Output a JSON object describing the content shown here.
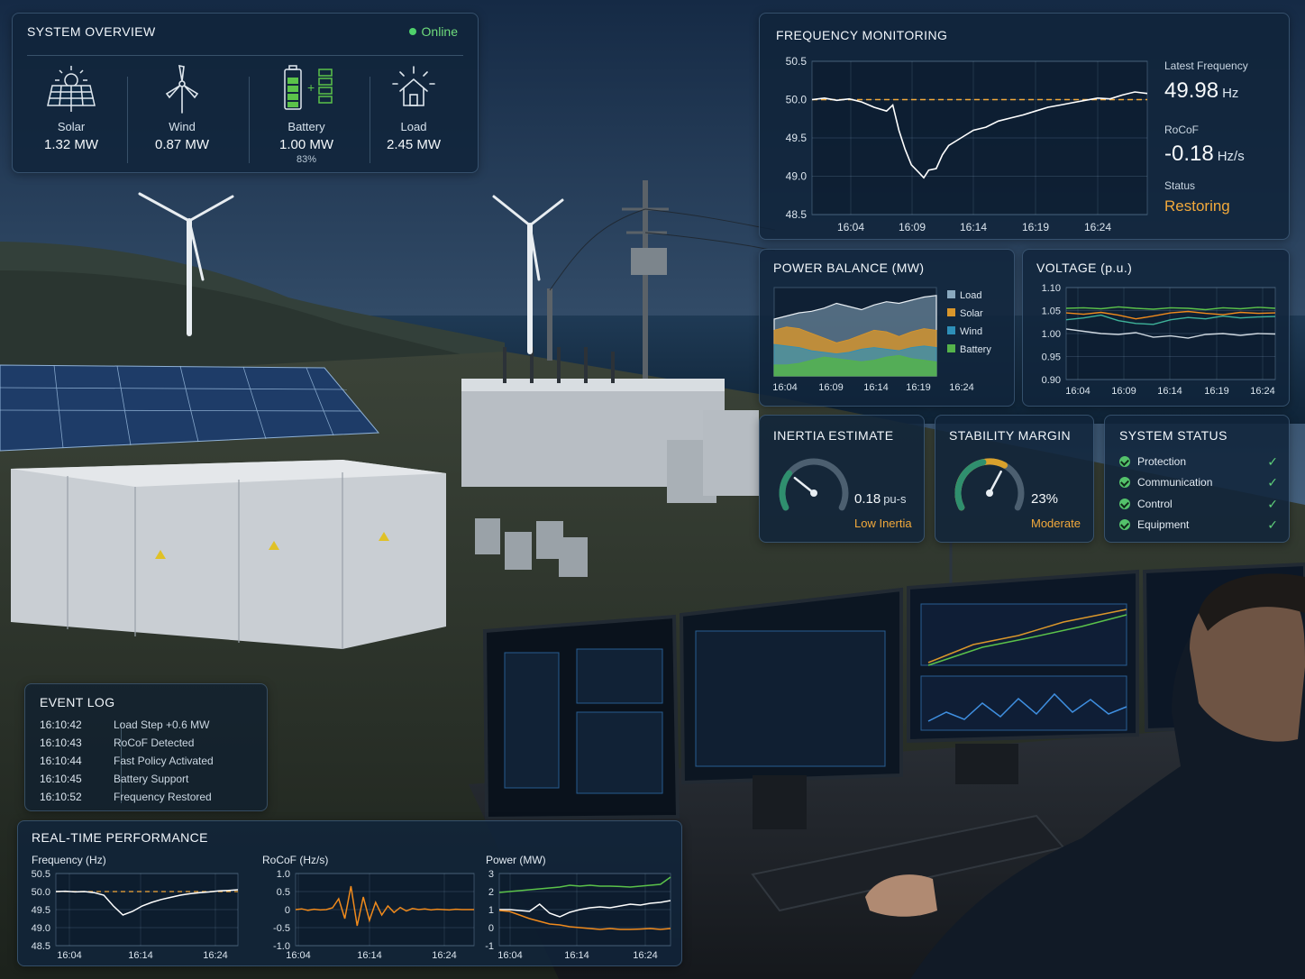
{
  "system_overview": {
    "title": "SYSTEM OVERVIEW",
    "status": "Online",
    "sources": [
      {
        "label": "Solar",
        "value": "1.32 MW",
        "icon": "solar-panel-icon"
      },
      {
        "label": "Wind",
        "value": "0.87 MW",
        "icon": "wind-turbine-icon"
      },
      {
        "label": "Battery",
        "value": "1.00 MW",
        "sub": "83%",
        "icon": "battery-icon"
      },
      {
        "label": "Load",
        "value": "2.45 MW",
        "icon": "house-load-icon"
      }
    ]
  },
  "frequency_monitoring": {
    "title": "FREQUENCY MONITORING",
    "latest_label": "Latest Frequency",
    "latest_value": "49.98",
    "latest_unit": "Hz",
    "rocof_label": "RoCoF",
    "rocof_value": "-0.18",
    "rocof_unit": "Hz/s",
    "status_label": "Status",
    "status_value": "Restoring"
  },
  "power_balance": {
    "title": "POWER BALANCE (MW)"
  },
  "voltage": {
    "title": "VOLTAGE (p.u.)"
  },
  "inertia": {
    "title": "INERTIA ESTIMATE",
    "value": "0.18",
    "unit": "pu-s",
    "note": "Low Inertia"
  },
  "stability": {
    "title": "STABILITY MARGIN",
    "value": "23%",
    "note": "Moderate"
  },
  "system_status": {
    "title": "SYSTEM STATUS",
    "items": [
      {
        "label": "Protection"
      },
      {
        "label": "Communication"
      },
      {
        "label": "Control"
      },
      {
        "label": "Equipment"
      }
    ]
  },
  "event_log": {
    "title": "EVENT LOG",
    "events": [
      {
        "time": "16:10:42",
        "text": "Load Step +0.6 MW"
      },
      {
        "time": "16:10:43",
        "text": "RoCoF Detected"
      },
      {
        "time": "16:10:44",
        "text": "Fast Policy Activated"
      },
      {
        "time": "16:10:45",
        "text": "Battery Support"
      },
      {
        "time": "16:10:52",
        "text": "Frequency Restored"
      }
    ]
  },
  "realtime": {
    "title": "REAL-TIME PERFORMANCE"
  },
  "colors": {
    "accent_orange": "#f2a93b",
    "online_green": "#4fd16b",
    "load": "#8aa9bf",
    "solar": "#d9962b",
    "wind": "#2e8fb8",
    "battery": "#55b34b",
    "trace_white": "#ffffff",
    "trace_orange": "#f08a1c",
    "trace_green": "#5bc24a"
  },
  "chart_data": [
    {
      "id": "freq_main",
      "type": "line",
      "title": "FREQUENCY MONITORING",
      "ylim": [
        48.5,
        50.5
      ],
      "y_ticks": [
        "48.5",
        "49.0",
        "49.5",
        "50.0",
        "50.5"
      ],
      "x_ticks": [
        "16:04",
        "16:09",
        "16:14",
        "16:19",
        "16:24"
      ],
      "xlim": [
        0,
        27
      ],
      "grid": true,
      "reference": 50.0,
      "series": [
        {
          "x": [
            0,
            1,
            2,
            3,
            4,
            5,
            6,
            6.5,
            7,
            7.5,
            8,
            8.6,
            9,
            9.4,
            10,
            10.5,
            11,
            12,
            13,
            14,
            15,
            16,
            17,
            18,
            19,
            20,
            21,
            22,
            23,
            24,
            25,
            26,
            27
          ],
          "y": [
            50.0,
            50.02,
            49.99,
            50.01,
            49.97,
            49.9,
            49.85,
            49.93,
            49.6,
            49.35,
            49.15,
            49.05,
            48.98,
            49.08,
            49.1,
            49.28,
            49.4,
            49.5,
            49.6,
            49.64,
            49.72,
            49.76,
            49.8,
            49.85,
            49.9,
            49.93,
            49.96,
            49.99,
            50.02,
            50.01,
            50.06,
            50.1,
            50.08
          ]
        }
      ]
    },
    {
      "id": "power_balance",
      "type": "area",
      "title": "POWER BALANCE (MW)",
      "x_ticks": [
        "16:04",
        "16:09",
        "16:14",
        "16:19",
        "16:24"
      ],
      "legend": "right",
      "series": [
        {
          "name": "Load",
          "values": [
            1.8,
            1.9,
            2.0,
            2.05,
            2.15,
            2.3,
            2.2,
            2.1,
            2.25,
            2.35,
            2.3,
            2.4,
            2.5,
            2.55
          ]
        },
        {
          "name": "Solar",
          "values": [
            1.45,
            1.55,
            1.5,
            1.35,
            1.2,
            1.05,
            1.15,
            1.3,
            1.45,
            1.4,
            1.25,
            1.4,
            1.5,
            1.45
          ]
        },
        {
          "name": "Wind",
          "values": [
            1.0,
            0.95,
            0.9,
            0.8,
            0.75,
            0.7,
            0.75,
            0.85,
            0.9,
            0.85,
            0.8,
            0.9,
            0.95,
            0.9
          ]
        },
        {
          "name": "Battery",
          "values": [
            0.35,
            0.35,
            0.4,
            0.5,
            0.6,
            0.55,
            0.5,
            0.45,
            0.5,
            0.6,
            0.65,
            0.55,
            0.5,
            0.45
          ]
        }
      ]
    },
    {
      "id": "voltage",
      "type": "line",
      "title": "VOLTAGE (p.u.)",
      "ylim": [
        0.9,
        1.1
      ],
      "y_ticks": [
        "1.10",
        "1.05",
        "1.00",
        "0.95",
        "0.90"
      ],
      "x_ticks": [
        "16:04",
        "16:09",
        "16:14",
        "16:19",
        "16:24"
      ],
      "series": [
        {
          "color": "#5bc24a",
          "values": [
            1.055,
            1.056,
            1.054,
            1.058,
            1.055,
            1.053,
            1.056,
            1.055,
            1.052,
            1.056,
            1.054,
            1.057,
            1.055
          ]
        },
        {
          "color": "#f08a1c",
          "values": [
            1.045,
            1.042,
            1.046,
            1.04,
            1.032,
            1.038,
            1.045,
            1.048,
            1.044,
            1.041,
            1.046,
            1.044,
            1.045
          ]
        },
        {
          "color": "#3fb39a",
          "values": [
            1.03,
            1.034,
            1.04,
            1.028,
            1.022,
            1.02,
            1.03,
            1.035,
            1.032,
            1.038,
            1.034,
            1.036,
            1.037
          ]
        },
        {
          "color": "#cfd8e0",
          "values": [
            1.01,
            1.005,
            1.0,
            0.998,
            1.002,
            0.992,
            0.995,
            0.99,
            0.998,
            1.0,
            0.996,
            1.0,
            0.999
          ]
        }
      ]
    },
    {
      "id": "inertia_gauge",
      "type": "gauge",
      "value": 0.18,
      "fraction": 0.28
    },
    {
      "id": "stability_gauge",
      "type": "gauge",
      "value": 23,
      "fraction": 0.62
    },
    {
      "id": "rt_freq",
      "type": "line",
      "title": "Frequency (Hz)",
      "ylim": [
        48.5,
        50.5
      ],
      "y_ticks": [
        "50.5",
        "50.0",
        "49.5",
        "49.0",
        "48.5"
      ],
      "x_ticks": [
        "16:04",
        "16:14",
        "16:24"
      ],
      "reference": 50.0,
      "series": [
        {
          "values": [
            50.0,
            50.01,
            49.99,
            50.0,
            49.97,
            49.9,
            49.6,
            49.35,
            49.45,
            49.6,
            49.7,
            49.78,
            49.84,
            49.9,
            49.94,
            49.97,
            49.99,
            50.02,
            50.03,
            50.05
          ]
        }
      ]
    },
    {
      "id": "rt_rocof",
      "type": "line",
      "title": "RoCoF (Hz/s)",
      "ylim": [
        -1.0,
        1.0
      ],
      "y_ticks": [
        "1.0",
        "0.5",
        "0",
        "-0.5",
        "-1.0"
      ],
      "x_ticks": [
        "16:04",
        "16:14",
        "16:24"
      ],
      "series": [
        {
          "values": [
            0.0,
            0.02,
            -0.02,
            0.01,
            -0.01,
            0.0,
            0.05,
            0.3,
            -0.25,
            0.65,
            -0.45,
            0.35,
            -0.3,
            0.2,
            -0.15,
            0.1,
            -0.08,
            0.06,
            -0.04,
            0.03,
            0.0,
            0.02,
            -0.01,
            0.01,
            0.0,
            -0.01,
            0.01,
            0.0,
            0.0,
            0.0
          ]
        }
      ]
    },
    {
      "id": "rt_power",
      "type": "line",
      "title": "Power (MW)",
      "ylim": [
        -1,
        3
      ],
      "y_ticks": [
        "3",
        "2",
        "1",
        "0",
        "-1"
      ],
      "x_ticks": [
        "16:04",
        "16:14",
        "16:24"
      ],
      "series": [
        {
          "color": "#5bc24a",
          "values": [
            1.95,
            2.0,
            2.05,
            2.1,
            2.15,
            2.2,
            2.25,
            2.35,
            2.3,
            2.35,
            2.3,
            2.3,
            2.28,
            2.25,
            2.3,
            2.35,
            2.4,
            2.8
          ]
        },
        {
          "color": "#ffffff",
          "values": [
            1.0,
            1.0,
            0.95,
            0.9,
            1.3,
            0.8,
            0.6,
            0.85,
            1.0,
            1.1,
            1.15,
            1.1,
            1.2,
            1.3,
            1.25,
            1.35,
            1.4,
            1.5
          ]
        },
        {
          "color": "#f08a1c",
          "values": [
            0.95,
            0.9,
            0.7,
            0.5,
            0.35,
            0.2,
            0.15,
            0.05,
            0.0,
            -0.05,
            -0.1,
            -0.05,
            -0.1,
            -0.1,
            -0.08,
            -0.05,
            -0.1,
            -0.05
          ]
        }
      ]
    }
  ]
}
